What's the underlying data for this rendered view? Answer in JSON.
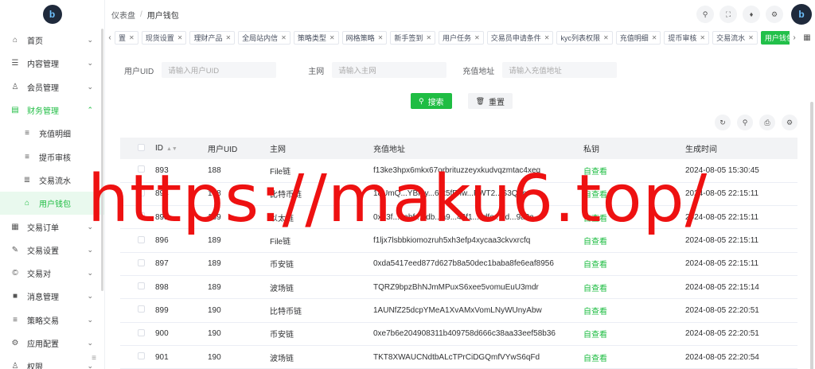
{
  "sidebar": {
    "items": [
      {
        "icon": "⌂",
        "icon_name": "home-icon",
        "label": "首页",
        "arrow": "⌄",
        "kind": "top"
      },
      {
        "icon": "☰",
        "icon_name": "list-icon",
        "label": "内容管理",
        "arrow": "⌄",
        "kind": "top"
      },
      {
        "icon": "♙",
        "icon_name": "user-icon",
        "label": "会员管理",
        "arrow": "⌄",
        "kind": "top"
      },
      {
        "icon": "▤",
        "icon_name": "finance-icon",
        "label": "财务管理",
        "arrow": "⌃",
        "kind": "open"
      },
      {
        "icon": "≡",
        "icon_name": "list-icon",
        "label": "充值明细",
        "arrow": "",
        "kind": "sub"
      },
      {
        "icon": "≡",
        "icon_name": "list-icon",
        "label": "提币审核",
        "arrow": "",
        "kind": "sub"
      },
      {
        "icon": "≣",
        "icon_name": "flow-icon",
        "label": "交易流水",
        "arrow": "",
        "kind": "sub"
      },
      {
        "icon": "⌂",
        "icon_name": "wallet-icon",
        "label": "用户钱包",
        "arrow": "",
        "kind": "active"
      },
      {
        "icon": "▦",
        "icon_name": "order-icon",
        "label": "交易订单",
        "arrow": "⌄",
        "kind": "top"
      },
      {
        "icon": "✎",
        "icon_name": "settings-icon",
        "label": "交易设置",
        "arrow": "⌄",
        "kind": "top"
      },
      {
        "icon": "©",
        "icon_name": "pair-icon",
        "label": "交易对",
        "arrow": "⌄",
        "kind": "top"
      },
      {
        "icon": "■",
        "icon_name": "message-icon",
        "label": "消息管理",
        "arrow": "⌄",
        "kind": "top"
      },
      {
        "icon": "≡",
        "icon_name": "strategy-icon",
        "label": "策略交易",
        "arrow": "⌄",
        "kind": "top"
      },
      {
        "icon": "⚙",
        "icon_name": "config-icon",
        "label": "应用配置",
        "arrow": "⌄",
        "kind": "top"
      },
      {
        "icon": "♙",
        "icon_name": "permission-icon",
        "label": "权限",
        "arrow": "⌄",
        "kind": "top"
      }
    ]
  },
  "header": {
    "breadcrumb": [
      "仪表盘",
      "用户钱包"
    ],
    "separator": "/",
    "tool_icons": [
      "search-icon",
      "fullscreen-icon",
      "bell-icon",
      "gear-icon"
    ]
  },
  "tabs": [
    {
      "label": "置",
      "active": false
    },
    {
      "label": "现货设置",
      "active": false
    },
    {
      "label": "理财产品",
      "active": false
    },
    {
      "label": "全局站内信",
      "active": false
    },
    {
      "label": "策略类型",
      "active": false
    },
    {
      "label": "网格策略",
      "active": false
    },
    {
      "label": "新手签到",
      "active": false
    },
    {
      "label": "用户任务",
      "active": false
    },
    {
      "label": "交易员申请条件",
      "active": false
    },
    {
      "label": "kyc列表权限",
      "active": false
    },
    {
      "label": "充值明细",
      "active": false
    },
    {
      "label": "提币审核",
      "active": false
    },
    {
      "label": "交易流水",
      "active": false
    },
    {
      "label": "用户钱包",
      "active": true
    }
  ],
  "filters": {
    "uid_label": "用户UID",
    "uid_placeholder": "请输入用户UID",
    "network_label": "主网",
    "network_placeholder": "请输入主网",
    "address_label": "充值地址",
    "address_placeholder": "请输入充值地址"
  },
  "buttons": {
    "search": "搜索",
    "reset": "重置"
  },
  "table": {
    "columns": [
      "ID",
      "用户UID",
      "主网",
      "充值地址",
      "私钥",
      "生成时间"
    ],
    "rows": [
      {
        "id": "893",
        "uid": "188",
        "network": "File链",
        "address": "f13ke3hpx6mkx67orbrituzzeyxkudvqzmtac4xeq",
        "key": "自查看",
        "time": "2024-08-05 15:30:45"
      },
      {
        "id": "894",
        "uid": "188",
        "network": "比特币链",
        "address": "18UmQ...YBmy...6ut5fFnw...FWT2...S3Q4e",
        "key": "自查看",
        "time": "2024-08-05 22:15:11"
      },
      {
        "id": "895",
        "uid": "189",
        "network": "以太链",
        "address": "0xe3f...aabf...4db...a9...46f1...cdfe...5d...9a3a...",
        "key": "自查看",
        "time": "2024-08-05 22:15:11"
      },
      {
        "id": "896",
        "uid": "189",
        "network": "File链",
        "address": "f1ljx7lsbbkiomozruh5xh3efp4xycaa3ckvxrcfq",
        "key": "自查看",
        "time": "2024-08-05 22:15:11"
      },
      {
        "id": "897",
        "uid": "189",
        "network": "币安链",
        "address": "0xda5417eed877d627b8a50dec1baba8fe6eaf8956",
        "key": "自查看",
        "time": "2024-08-05 22:15:11"
      },
      {
        "id": "898",
        "uid": "189",
        "network": "波场链",
        "address": "TQRZ9bpzBhNJmMPuxS6xee5vomuEuU3mdr",
        "key": "自查看",
        "time": "2024-08-05 22:15:14"
      },
      {
        "id": "899",
        "uid": "190",
        "network": "比特币链",
        "address": "1AUNfZ25dcpYMeA1XvAMxVomLNyWUnyAbw",
        "key": "自查看",
        "time": "2024-08-05 22:20:51"
      },
      {
        "id": "900",
        "uid": "190",
        "network": "币安链",
        "address": "0xe7b6e204908311b409758d666c38aa33eef58b36",
        "key": "自查看",
        "time": "2024-08-05 22:20:51"
      },
      {
        "id": "901",
        "uid": "190",
        "network": "波场链",
        "address": "TKT8XWAUCNdtbALcTPrCiDGQmfVYwS6qFd",
        "key": "自查看",
        "time": "2024-08-05 22:20:54"
      }
    ]
  },
  "watermark": "https://maku6.top/",
  "colors": {
    "accent": "#1fbd43",
    "watermark": "#ee1111"
  }
}
